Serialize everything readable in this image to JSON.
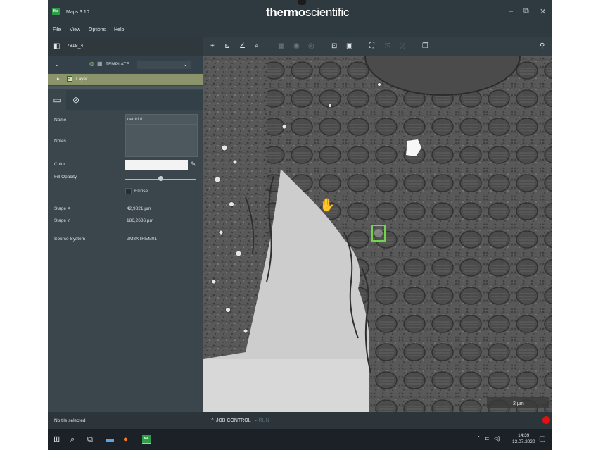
{
  "window": {
    "app_title": "Maps 3.10",
    "app_logo": "Ma",
    "brand_bold": "thermo",
    "brand_light": "scientific",
    "controls": {
      "minimize": "–",
      "maximize": "⧉",
      "close": "✕"
    }
  },
  "menu": [
    "File",
    "View",
    "Options",
    "Help"
  ],
  "project": {
    "name": "7819_4"
  },
  "layers": {
    "template_label": "TEMPLATE",
    "layer_name": "Layer"
  },
  "properties": {
    "name_label": "Name",
    "name_value": "centriol",
    "notes_label": "Notes",
    "color_label": "Color",
    "color_value": "#f3f3f3",
    "fill_opacity_label": "Fill Opacity",
    "fill_opacity": 0.55,
    "ellipse_label": "Ellipse",
    "stage_x_label": "Stage X",
    "stage_x_value": "42,9821 µm",
    "stage_y_label": "Stage Y",
    "stage_y_value": "186,2636 µm",
    "source_label": "Source System",
    "source_value": "ZM8XTREM01"
  },
  "canvas": {
    "scale_label": "2 µm",
    "selection_color": "#6fd64a"
  },
  "status": {
    "no_tile": "No tile selected",
    "job_control": "JOB CONTROL",
    "run": "RUN"
  },
  "taskbar": {
    "time": "14:39",
    "date": "13.07.2020"
  },
  "colors": {
    "accent_green": "#2e9d47",
    "layer_row": "#8a936a",
    "record": "#e01212"
  }
}
